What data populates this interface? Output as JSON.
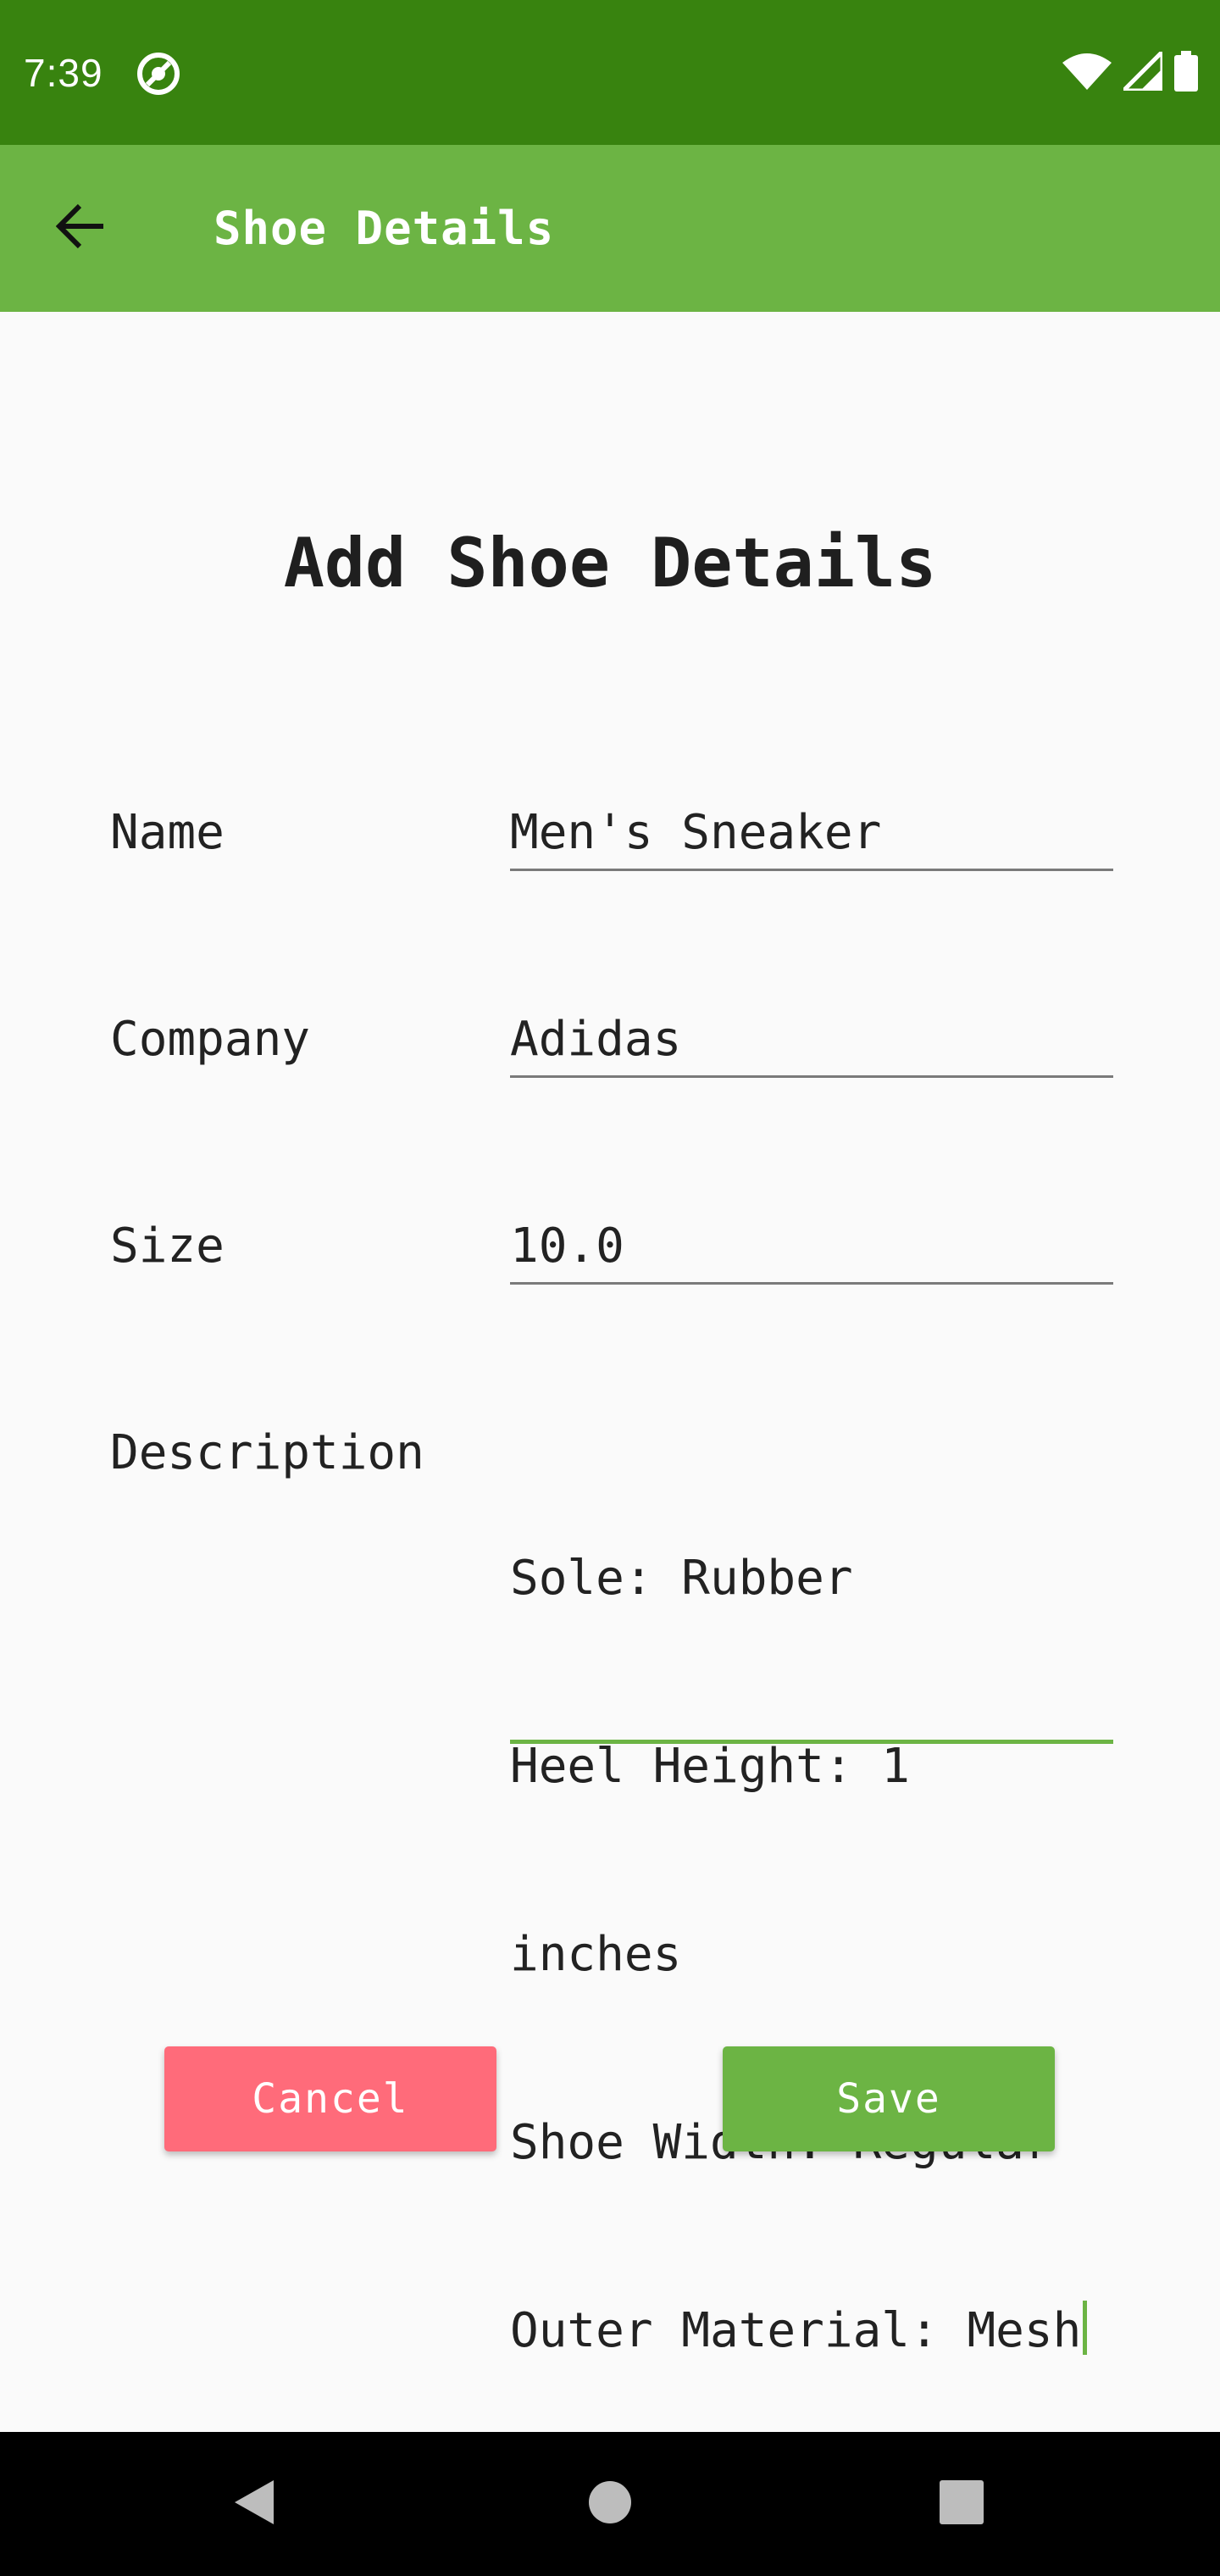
{
  "status_bar": {
    "time": "7:39",
    "app_icon": "circular-app-notification-icon",
    "icons": [
      "wifi-icon",
      "signal-icon",
      "battery-icon"
    ],
    "background_color": "#38830F"
  },
  "app_bar": {
    "title": "Shoe Details",
    "back_icon": "back-arrow-icon",
    "background_color": "#6CB444"
  },
  "form": {
    "heading": "Add Shoe Details",
    "fields": {
      "name": {
        "label": "Name",
        "value": "Men's Sneaker"
      },
      "company": {
        "label": "Company",
        "value": "Adidas"
      },
      "size": {
        "label": "Size",
        "value": "10.0"
      },
      "description": {
        "label": "Description",
        "lines": [
          "Sole: Rubber",
          "Heel Height: 1",
          "inches",
          "Shoe Width: Regular",
          "Outer Material: Mesh"
        ],
        "focused": true
      }
    }
  },
  "actions": {
    "cancel_label": "Cancel",
    "save_label": "Save",
    "cancel_color": "#FF6B7A",
    "save_color": "#6CB444"
  },
  "nav_bar": {
    "icons": [
      "nav-back-icon",
      "nav-home-icon",
      "nav-recents-icon"
    ]
  }
}
